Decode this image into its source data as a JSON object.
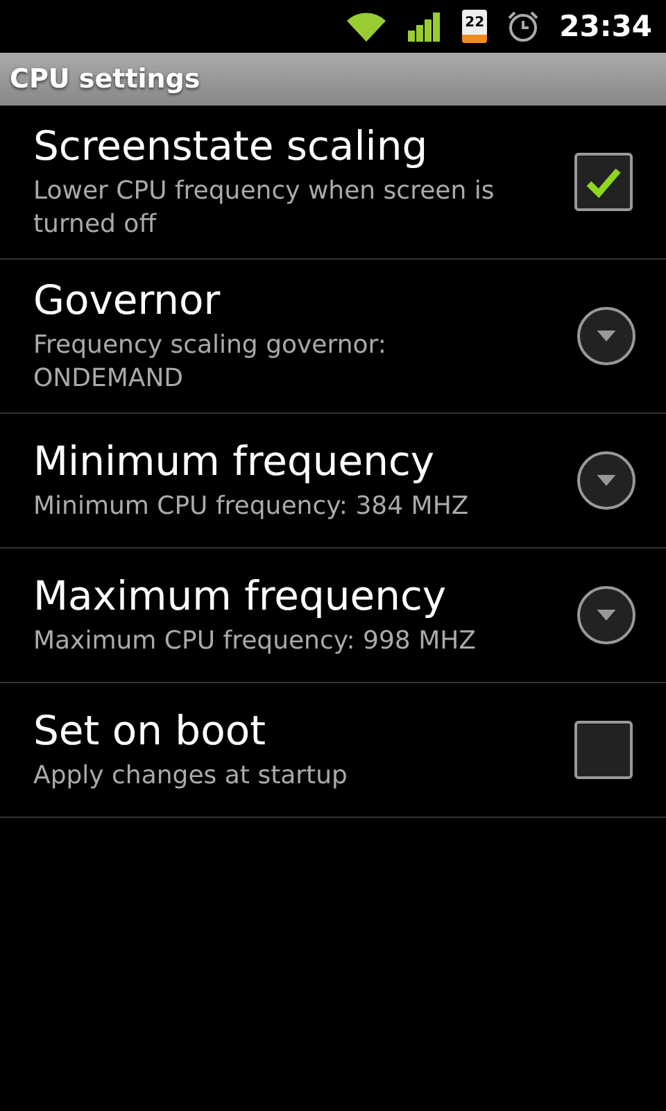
{
  "status_bar": {
    "battery_text": "22",
    "time": "23:34"
  },
  "title": "CPU settings",
  "settings": [
    {
      "kind": "checkbox",
      "title": "Screenstate scaling",
      "summary": "Lower CPU frequency when screen is turned off",
      "checked": true
    },
    {
      "kind": "list",
      "title": "Governor",
      "summary": "Frequency scaling governor: ONDEMAND"
    },
    {
      "kind": "list",
      "title": "Minimum frequency",
      "summary": "Minimum CPU frequency: 384 MHZ"
    },
    {
      "kind": "list",
      "title": "Maximum frequency",
      "summary": "Maximum CPU frequency: 998 MHZ"
    },
    {
      "kind": "checkbox",
      "title": "Set on boot",
      "summary": "Apply changes at startup",
      "checked": false
    }
  ]
}
